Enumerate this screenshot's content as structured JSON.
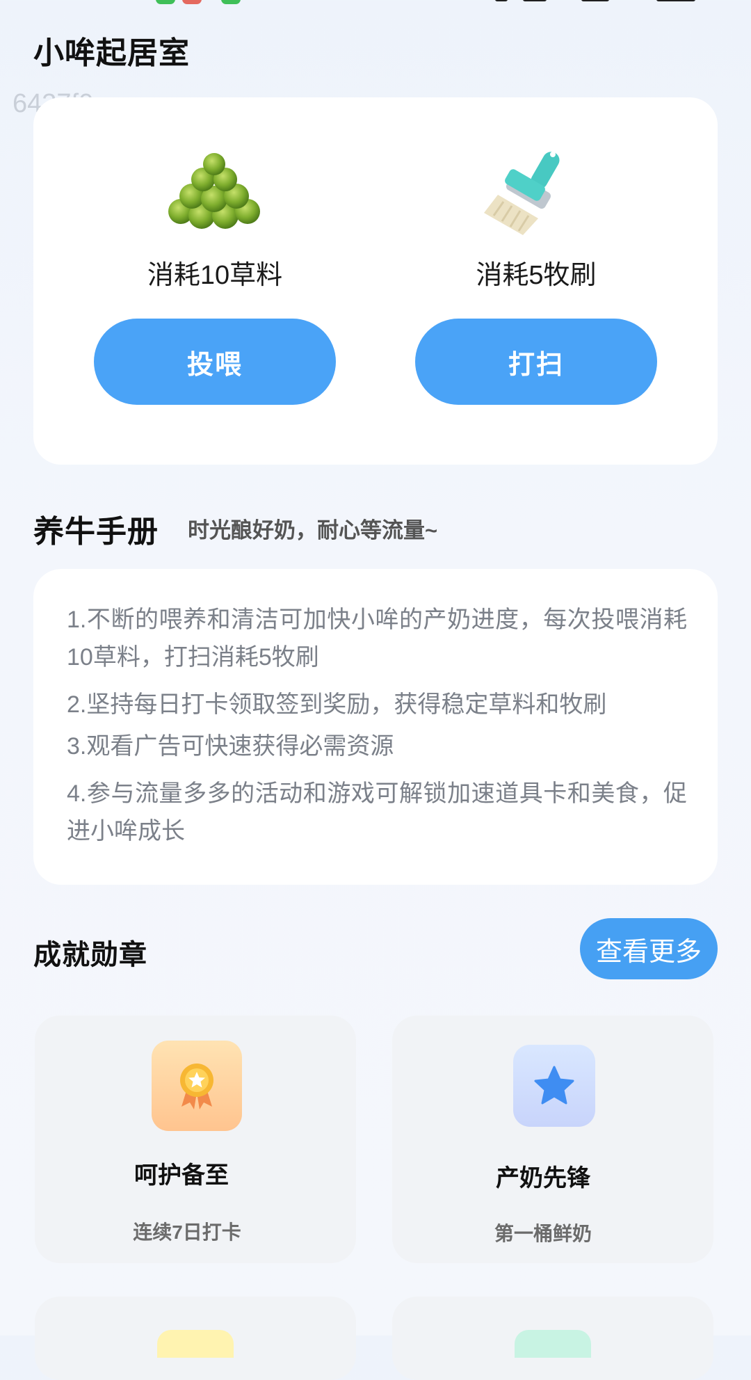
{
  "watermark": "6437f0",
  "room": {
    "title": "小哞起居室",
    "feed": {
      "cost_label": "消耗10草料",
      "button_label": "投喂",
      "icon": "grass-pellets-icon"
    },
    "clean": {
      "cost_label": "消耗5牧刷",
      "button_label": "打扫",
      "icon": "brush-icon"
    }
  },
  "handbook": {
    "title": "养牛手册",
    "subtitle": "时光酿好奶，耐心等流量~",
    "rules": [
      "1.不断的喂养和清洁可加快小哞的产奶进度，每次投喂消耗10草料，打扫消耗5牧刷",
      "2.坚持每日打卡领取签到奖励，获得稳定草料和牧刷",
      "3.观看广告可快速获得必需资源",
      "4.参与流量多多的活动和游戏可解锁加速道具卡和美食，促进小哞成长"
    ]
  },
  "achievements": {
    "title": "成就勋章",
    "more_label": "查看更多",
    "badges": [
      {
        "title": "呵护备至",
        "desc": "连续7日打卡",
        "icon": "ribbon-medal-icon",
        "color": "#fb9a5a"
      },
      {
        "title": "产奶先锋",
        "desc": "第一桶鲜奶",
        "icon": "star-icon",
        "color": "#3f8df2"
      }
    ]
  }
}
